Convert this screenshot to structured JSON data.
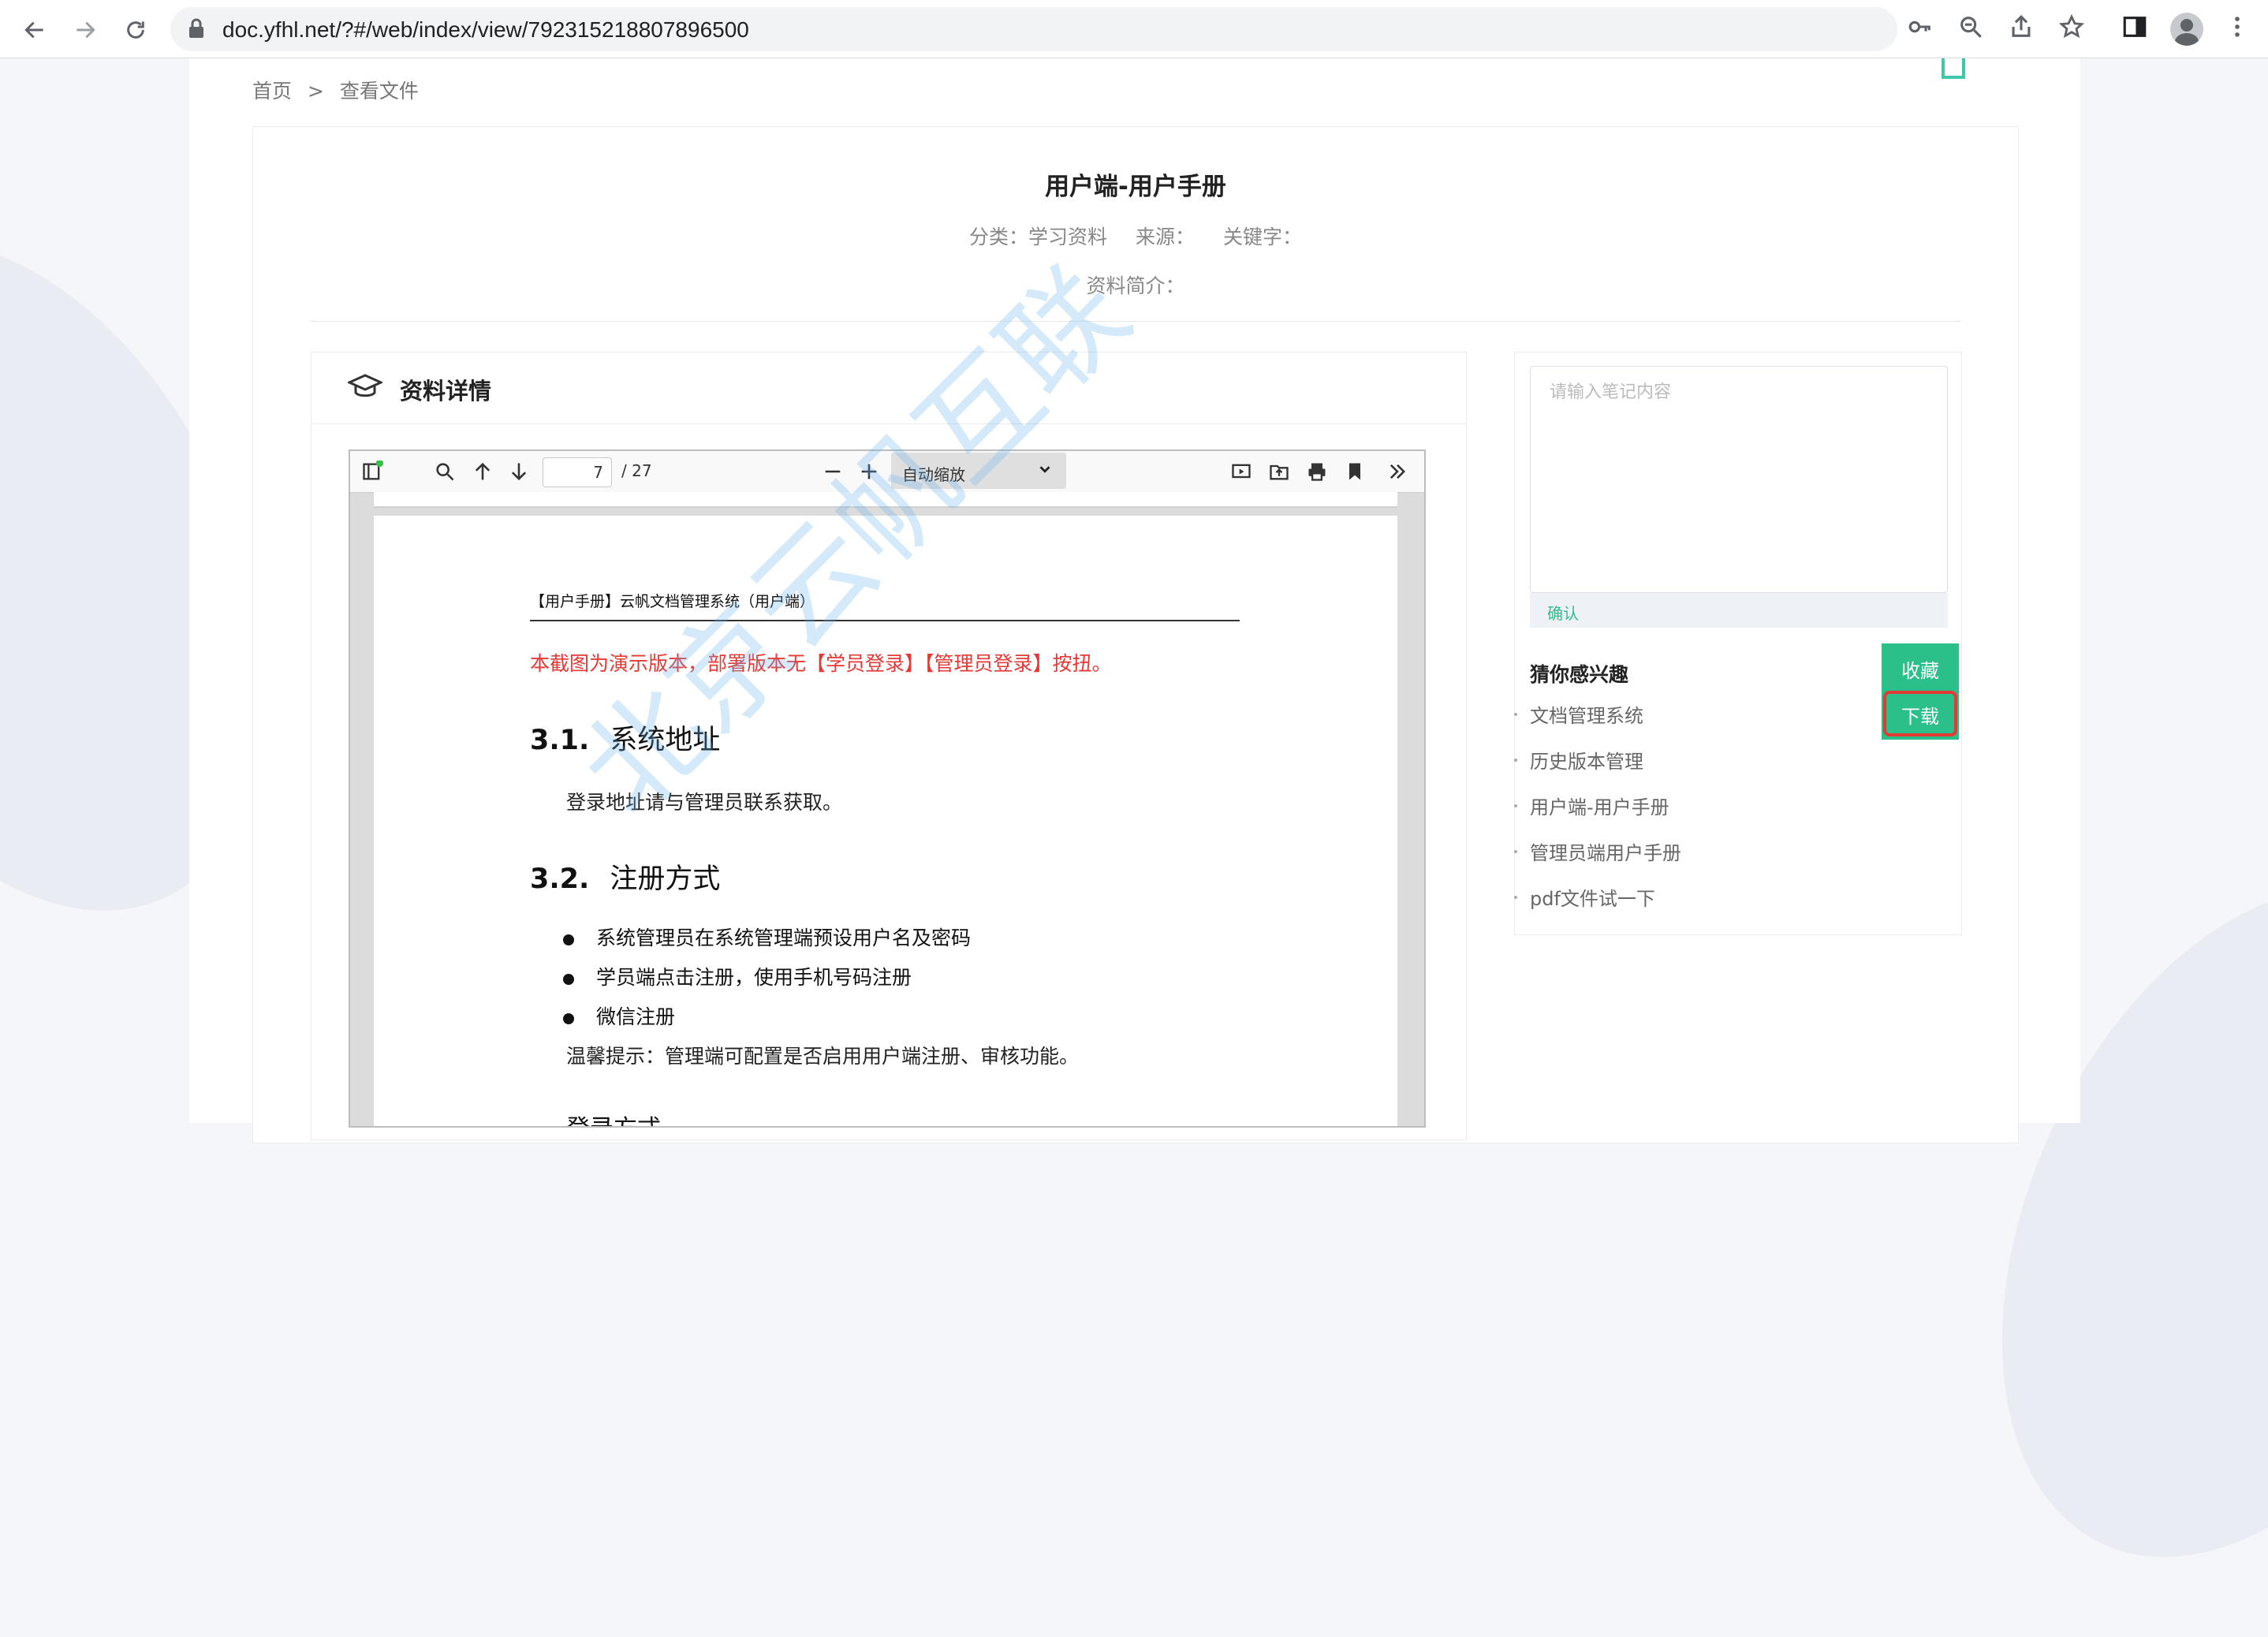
{
  "browser": {
    "url": "doc.yfhl.net/?#/web/index/view/792315218807896500",
    "icons": [
      "back-icon",
      "forward-icon",
      "reload-icon",
      "lock-icon",
      "key-icon",
      "zoom-icon",
      "share-icon",
      "star-icon",
      "sidebar-icon",
      "profile-icon",
      "menu-icon"
    ]
  },
  "breadcrumb": {
    "home": "首页",
    "separator": ">",
    "current": "查看文件"
  },
  "document": {
    "title": "用户端-用户手册",
    "category_label": "分类：学习资料",
    "source_label": "来源：",
    "keywords_label": "关键字：",
    "summary_label": "资料简介："
  },
  "detail": {
    "title": "资料详情"
  },
  "viewer": {
    "page_current": "7",
    "page_total": "/ 27",
    "zoom": "自动缩放",
    "watermark": "北京云帆互联",
    "content": {
      "header": "【用户手册】云帆文档管理系统（用户端）",
      "notice": "本截图为演示版本，部署版本无【学员登录】【管理员登录】按扭。",
      "section1_num": "3.1.",
      "section1_title": "系统地址",
      "section1_body": "登录地址请与管理员联系获取。",
      "section2_num": "3.2.",
      "section2_title": "注册方式",
      "bullets": [
        "系统管理员在系统管理端预设用户名及密码",
        "学员端点击注册，使用手机号码注册",
        "微信注册"
      ],
      "tip": "温馨提示：管理端可配置是否启用用户端注册、审核功能。",
      "next_heading": "登录方式"
    }
  },
  "notes": {
    "placeholder": "请输入笔记内容",
    "confirm": "确认"
  },
  "recommend": {
    "title": "猜你感兴趣",
    "items": [
      "文档管理系统",
      "历史版本管理",
      "用户端-用户手册",
      "管理员端用户手册",
      "pdf文件试一下"
    ]
  },
  "actions": {
    "favorite": "收藏",
    "download": "下载"
  },
  "colors": {
    "accent": "#2bbf8a",
    "highlight": "#e53935",
    "teal_mark": "#3ec7a8"
  }
}
